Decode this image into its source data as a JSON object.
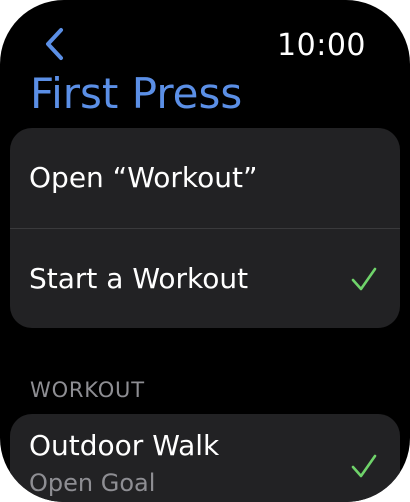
{
  "status": {
    "time": "10:00"
  },
  "nav": {
    "back_icon": "chevron-left-icon",
    "title": "First Press"
  },
  "colors": {
    "title": "#5b8fe6",
    "check": "#6fd36a",
    "cell_bg": "#222224",
    "secondary_text": "#8e8e93"
  },
  "options": [
    {
      "label": "Open “Workout”",
      "selected": false
    },
    {
      "label": "Start a Workout",
      "selected": true
    }
  ],
  "workout_section": {
    "header": "WORKOUT",
    "item": {
      "title": "Outdoor Walk",
      "subtitle": "Open Goal",
      "selected": true
    }
  }
}
